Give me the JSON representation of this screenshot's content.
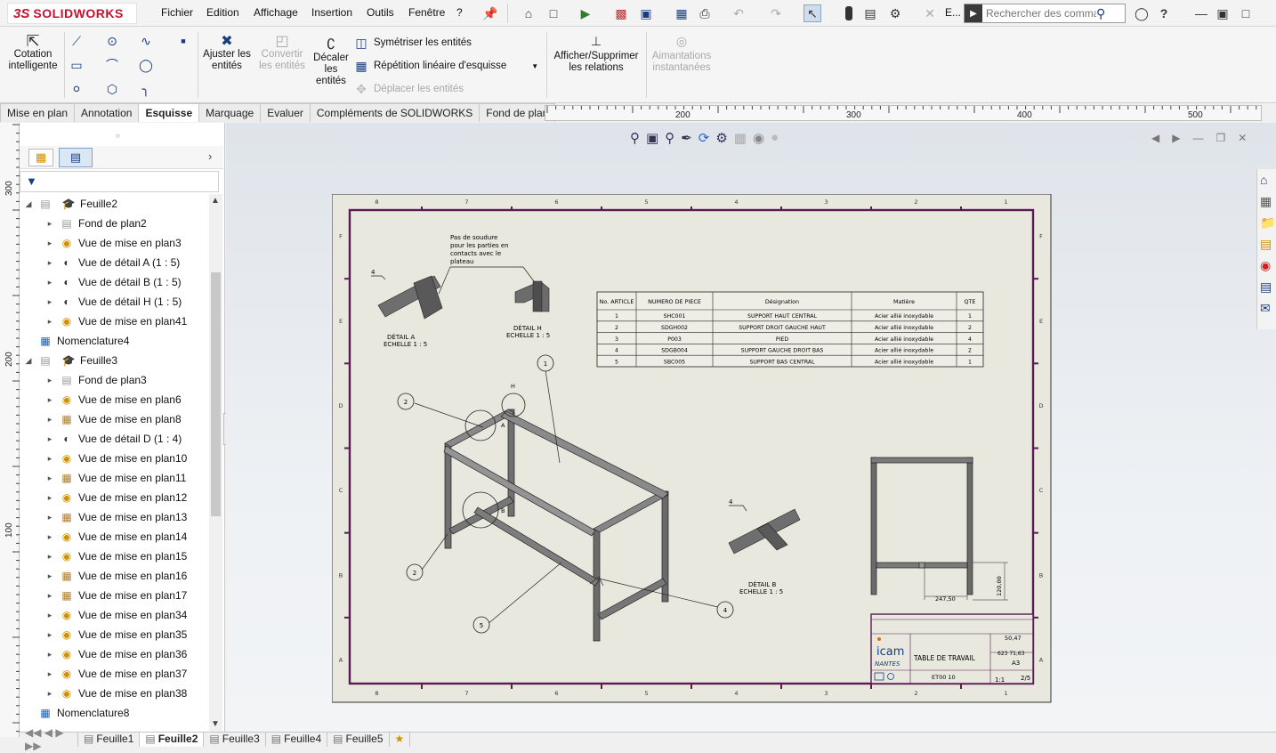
{
  "app": {
    "logo_prefix": "3S",
    "logo_name": "SOLIDWORKS"
  },
  "menu": [
    "Fichier",
    "Edition",
    "Affichage",
    "Insertion",
    "Outils",
    "Fenêtre",
    "?"
  ],
  "toolbar_extra": "E...",
  "search": {
    "placeholder": "Rechercher des comma"
  },
  "ribbon": {
    "smart_dim": "Cotation\nintelligente",
    "trim": "Ajuster les\nentités",
    "convert": "Convertir\nles entités",
    "offset": "Décaler\nles\nentités",
    "mirror": "Symétriser les entités",
    "linear_pattern": "Répétition linéaire d'esquisse",
    "move": "Déplacer les entités",
    "relations": "Afficher/Supprimer\nles relations",
    "snaps": "Aimantations\ninstantanées"
  },
  "tabs": [
    "Mise en plan",
    "Annotation",
    "Esquisse",
    "Marquage",
    "Evaluer",
    "Compléments de SOLIDWORKS",
    "Fond de plan"
  ],
  "active_tab": "Esquisse",
  "ruler_top": [
    "200",
    "300",
    "400",
    "500"
  ],
  "ruler_left": [
    "300",
    "200",
    "100"
  ],
  "tree": [
    {
      "label": "Feuille2",
      "level": 0,
      "type": "sheet",
      "expanded": true
    },
    {
      "label": "Fond de plan2",
      "level": 1,
      "type": "format"
    },
    {
      "label": "Vue de mise en plan3",
      "level": 1,
      "type": "view"
    },
    {
      "label": "Vue de détail A (1 : 5)",
      "level": 1,
      "type": "detail"
    },
    {
      "label": "Vue de détail B (1 : 5)",
      "level": 1,
      "type": "detail"
    },
    {
      "label": "Vue de détail H (1 : 5)",
      "level": 1,
      "type": "detail"
    },
    {
      "label": "Vue de mise en plan41",
      "level": 1,
      "type": "view"
    },
    {
      "label": "Nomenclature4",
      "level": 0,
      "type": "bom"
    },
    {
      "label": "Feuille3",
      "level": 0,
      "type": "sheet",
      "expanded": true
    },
    {
      "label": "Fond de plan3",
      "level": 1,
      "type": "format"
    },
    {
      "label": "Vue de mise en plan6",
      "level": 1,
      "type": "view"
    },
    {
      "label": "Vue de mise en plan8",
      "level": 1,
      "type": "view2"
    },
    {
      "label": "Vue de détail D (1 : 4)",
      "level": 1,
      "type": "detail"
    },
    {
      "label": "Vue de mise en plan10",
      "level": 1,
      "type": "view"
    },
    {
      "label": "Vue de mise en plan11",
      "level": 1,
      "type": "view2"
    },
    {
      "label": "Vue de mise en plan12",
      "level": 1,
      "type": "view"
    },
    {
      "label": "Vue de mise en plan13",
      "level": 1,
      "type": "view2"
    },
    {
      "label": "Vue de mise en plan14",
      "level": 1,
      "type": "view"
    },
    {
      "label": "Vue de mise en plan15",
      "level": 1,
      "type": "view"
    },
    {
      "label": "Vue de mise en plan16",
      "level": 1,
      "type": "view2"
    },
    {
      "label": "Vue de mise en plan17",
      "level": 1,
      "type": "view2"
    },
    {
      "label": "Vue de mise en plan34",
      "level": 1,
      "type": "view"
    },
    {
      "label": "Vue de mise en plan35",
      "level": 1,
      "type": "view"
    },
    {
      "label": "Vue de mise en plan36",
      "level": 1,
      "type": "view"
    },
    {
      "label": "Vue de mise en plan37",
      "level": 1,
      "type": "view"
    },
    {
      "label": "Vue de mise en plan38",
      "level": 1,
      "type": "view"
    },
    {
      "label": "Nomenclature8",
      "level": 0,
      "type": "bom"
    }
  ],
  "sheet_tabs": [
    "Feuille1",
    "Feuille2",
    "Feuille3",
    "Feuille4",
    "Feuille5"
  ],
  "active_sheet": "Feuille2",
  "drawing": {
    "border_cols": [
      "8",
      "7",
      "6",
      "5",
      "4",
      "3",
      "2",
      "1"
    ],
    "border_rows": [
      "F",
      "E",
      "D",
      "C",
      "B",
      "A"
    ],
    "note": [
      "Pas de soudure",
      "pour les parties en",
      "contacts avec le",
      "plateau"
    ],
    "detail_a": [
      "DÉTAIL A",
      "ECHELLE 1 : 5"
    ],
    "detail_h": [
      "DÉTAIL H",
      "ECHELLE 1 : 5"
    ],
    "detail_b": [
      "DÉTAIL B",
      "ECHELLE 1 : 5"
    ],
    "weld_symbol": "4",
    "bom_headers": [
      "No. ARTICLE",
      "NUMERO DE PIECE",
      "Désignation",
      "Matière",
      "QTE"
    ],
    "bom_rows": [
      [
        "1",
        "SHC001",
        "SUPPORT HAUT CENTRAL",
        "Acier allié inoxydable",
        "1"
      ],
      [
        "2",
        "SDGH002",
        "SUPPORT DROIT GAUCHE HAUT",
        "Acier allié inoxydable",
        "2"
      ],
      [
        "3",
        "P003",
        "PIED",
        "Acier allié inoxydable",
        "4"
      ],
      [
        "4",
        "SDGB004",
        "SUPPORT GAUCHE DROIT BAS",
        "Acier allié inoxydable",
        "2"
      ],
      [
        "5",
        "SBC005",
        "SUPPORT BAS CENTRAL",
        "Acier allié inoxydable",
        "1"
      ]
    ],
    "balloons": [
      "1",
      "2",
      "2",
      "4",
      "5"
    ],
    "circle_labels": [
      "A",
      "H",
      "B"
    ],
    "dims": [
      "247,50",
      "120,00"
    ],
    "title_block": {
      "logo": "icam",
      "city": "NANTES",
      "title": "TABLE DE TRAVAIL",
      "code": "ET00 10",
      "mass": "50,47",
      "format": "A3",
      "scale": "1:1",
      "sheet": "2/5",
      "ref": "623 71,63"
    }
  },
  "colors": {
    "accent": "#1a3d7c",
    "sheet_border": "#5a1a52",
    "sheet_bg": "#e8e8df",
    "logo_red": "#c8102e"
  }
}
